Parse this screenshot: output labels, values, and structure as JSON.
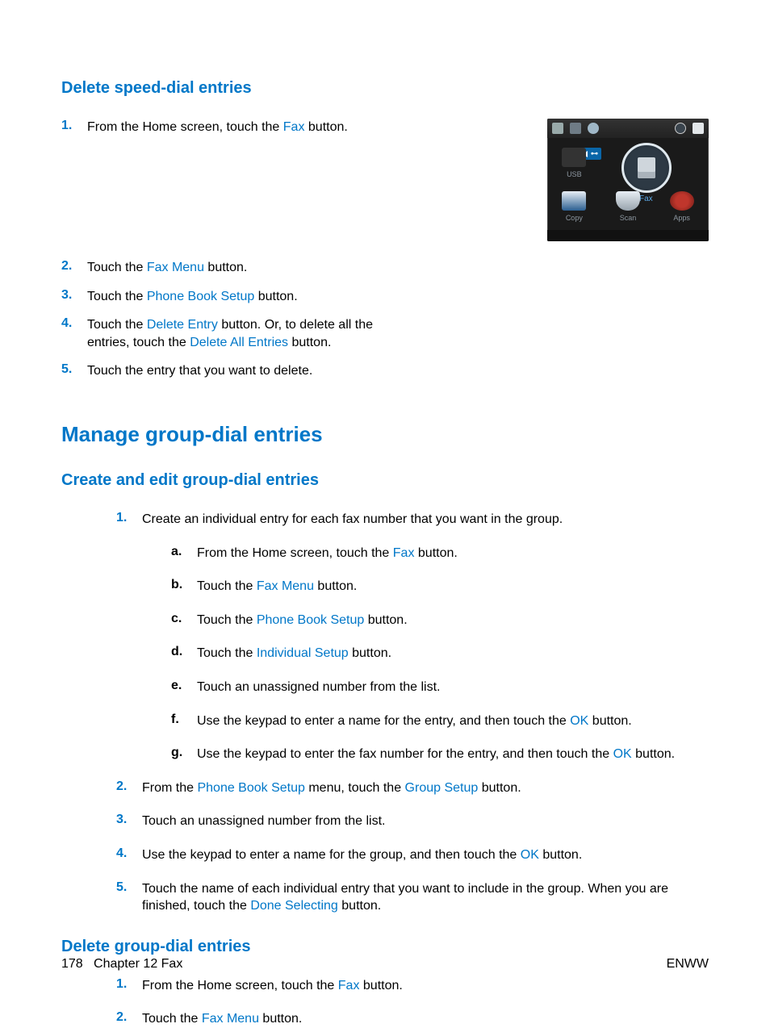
{
  "section1": {
    "heading": "Delete speed-dial entries",
    "screenshot": {
      "usb_badge": "USB",
      "fax_label": "Fax",
      "cells": {
        "usb": "USB",
        "copy": "Copy",
        "scan": "Scan",
        "apps": "Apps"
      }
    },
    "steps": [
      {
        "n": "1.",
        "pre": "From the Home screen, touch the ",
        "link": "Fax",
        "post": " button."
      },
      {
        "n": "2.",
        "pre": "Touch the ",
        "link": "Fax Menu",
        "post": " button."
      },
      {
        "n": "3.",
        "pre": "Touch the ",
        "link": "Phone Book Setup",
        "post": " button."
      },
      {
        "n": "4.",
        "pre": "Touch the ",
        "link": "Delete Entry",
        "mid": " button. Or, to delete all the entries, touch the ",
        "link2": "Delete All Entries",
        "post": " button."
      },
      {
        "n": "5.",
        "pre": "Touch the entry that you want to delete."
      }
    ]
  },
  "section2": {
    "heading": "Manage group-dial entries",
    "sub1": {
      "heading": "Create and edit group-dial entries",
      "steps": [
        {
          "n": "1.",
          "text": "Create an individual entry for each fax number that you want in the group.",
          "sub": [
            {
              "l": "a.",
              "pre": "From the Home screen, touch the ",
              "link": "Fax",
              "post": " button."
            },
            {
              "l": "b.",
              "pre": "Touch the ",
              "link": "Fax Menu",
              "post": " button."
            },
            {
              "l": "c.",
              "pre": "Touch the ",
              "link": "Phone Book Setup",
              "post": " button."
            },
            {
              "l": "d.",
              "pre": "Touch the ",
              "link": "Individual Setup",
              "post": " button."
            },
            {
              "l": "e.",
              "pre": "Touch an unassigned number from the list."
            },
            {
              "l": "f.",
              "pre": "Use the keypad to enter a name for the entry, and then touch the ",
              "link": "OK",
              "post": " button."
            },
            {
              "l": "g.",
              "pre": "Use the keypad to enter the fax number for the entry, and then touch the ",
              "link": "OK",
              "post": " button."
            }
          ]
        },
        {
          "n": "2.",
          "pre": "From the ",
          "link": "Phone Book Setup",
          "mid": " menu, touch the ",
          "link2": "Group Setup",
          "post": " button."
        },
        {
          "n": "3.",
          "pre": "Touch an unassigned number from the list."
        },
        {
          "n": "4.",
          "pre": "Use the keypad to enter a name for the group, and then touch the ",
          "link": "OK",
          "post": " button."
        },
        {
          "n": "5.",
          "pre": "Touch the name of each individual entry that you want to include in the group. When you are finished, touch the ",
          "link": "Done Selecting",
          "post": " button."
        }
      ]
    },
    "sub2": {
      "heading": "Delete group-dial entries",
      "steps": [
        {
          "n": "1.",
          "pre": "From the Home screen, touch the ",
          "link": "Fax",
          "post": " button."
        },
        {
          "n": "2.",
          "pre": "Touch the ",
          "link": "Fax Menu",
          "post": " button."
        }
      ]
    }
  },
  "footer": {
    "page": "178",
    "chapter": "Chapter 12   Fax",
    "right": "ENWW"
  }
}
